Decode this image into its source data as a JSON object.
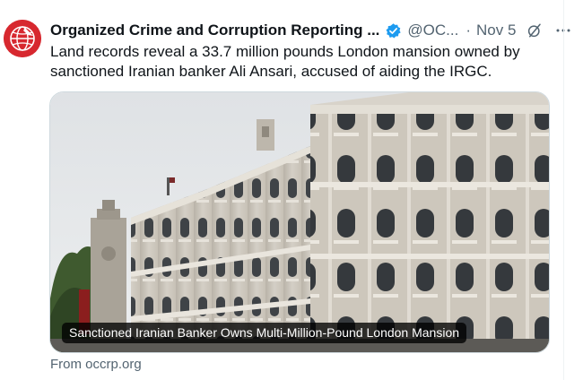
{
  "tweet": {
    "author_name": "Organized Crime and Corruption Reporting ...",
    "handle": "@OC...",
    "separator": "·",
    "date": "Nov 5",
    "text": "Land records reveal a 33.7 million pounds London mansion owned by sanctioned Iranian banker Ali Ansari, accused of aiding the IRGC.",
    "avatar_icon": "globe-logo-icon",
    "verified_icon": "verified-badge-icon",
    "verified_color": "#1d9bf0",
    "grok_icon": "grok-icon",
    "more_icon": "more-options-icon"
  },
  "card": {
    "title": "Sanctioned Iranian Banker Owns Multi-Million-Pound London Mansion",
    "source": "From occrp.org",
    "image_icon": "building-photo"
  }
}
